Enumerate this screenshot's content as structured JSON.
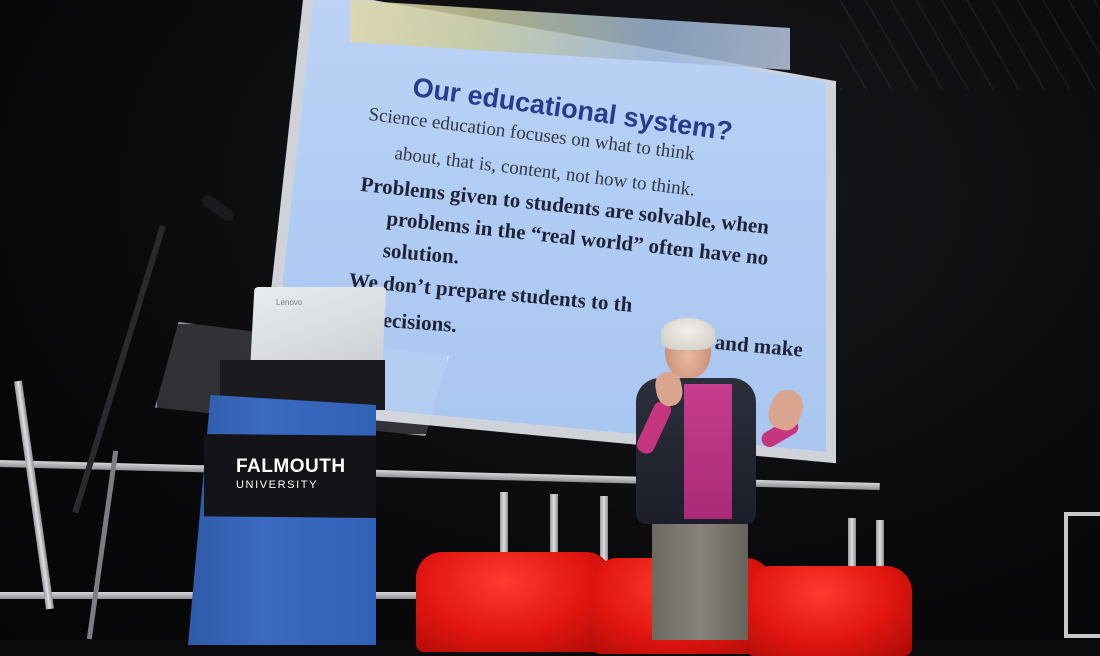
{
  "slide": {
    "title": "Our educational system?",
    "lines": [
      "Science education focuses on what to think",
      "about, that is, content,  not how to think.",
      "Problems given to students are solvable, when",
      "problems in the “real world” often have no",
      "solution.",
      "We don’t prepare students to th",
      "and make",
      "decisions."
    ]
  },
  "lectern": {
    "brand_main": "FALMOUTH",
    "brand_sub": "UNIVERSITY"
  },
  "laptop": {
    "brand": "Lenovo"
  },
  "colors": {
    "slide_background": "#b2cdf4",
    "slide_title": "#2b3a8c",
    "lectern_blue": "#3062b6",
    "chairs": "#e0150f",
    "shirt": "#c83c8e"
  }
}
